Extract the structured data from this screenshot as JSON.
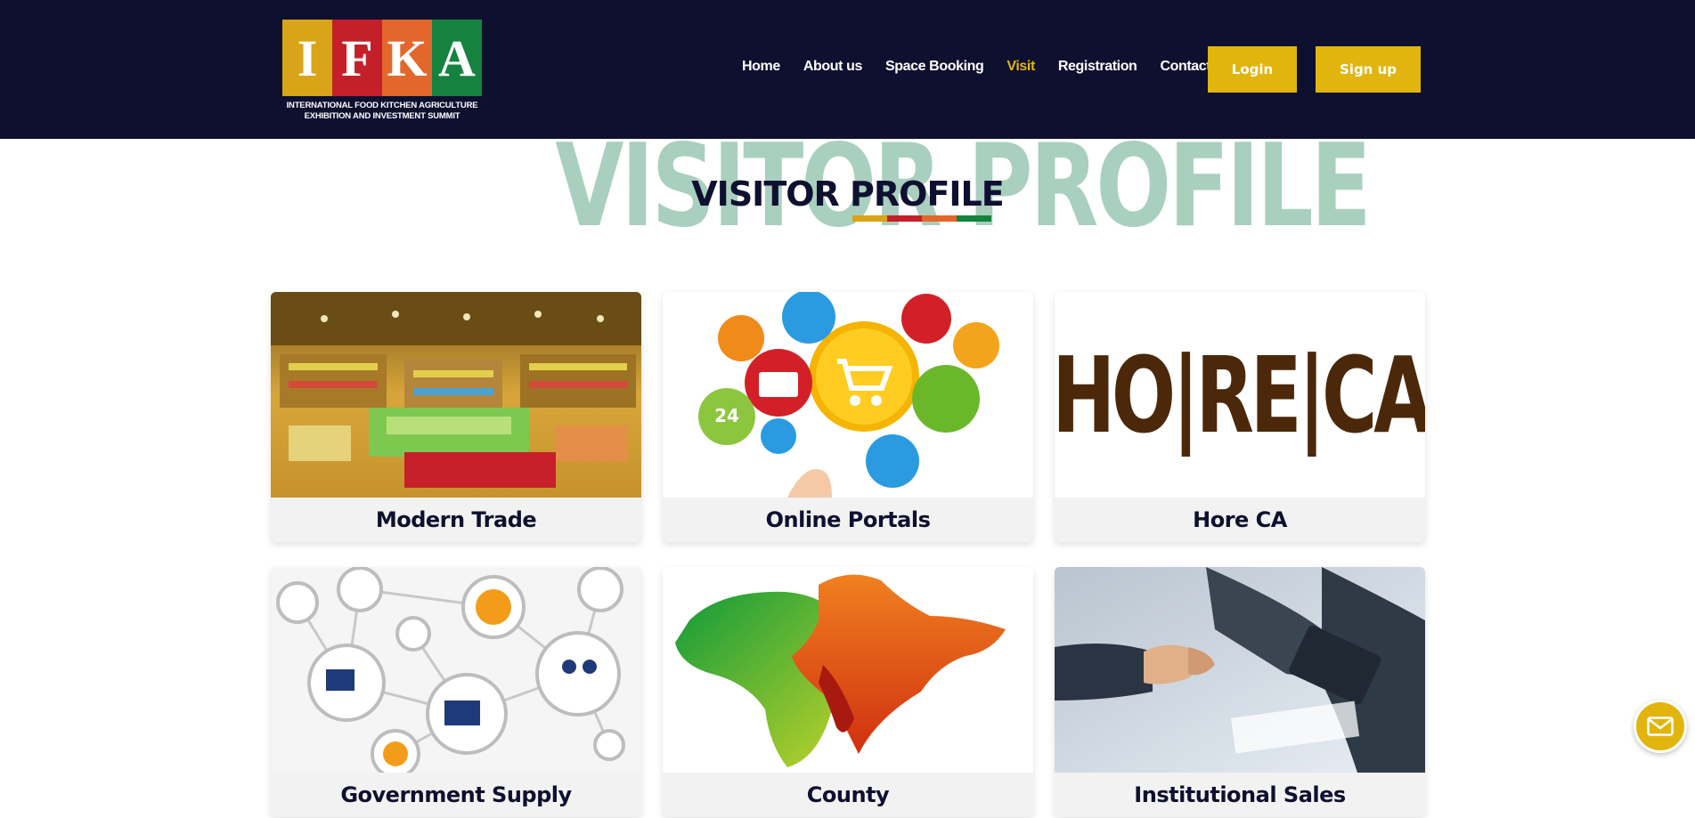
{
  "brand": {
    "letters": [
      "I",
      "F",
      "K",
      "A"
    ],
    "letter_colors": [
      "#d9a417",
      "#c5202a",
      "#e2672b",
      "#16823f"
    ],
    "tagline_line1": "INTERNATIONAL FOOD KITCHEN AGRICULTURE",
    "tagline_line2": "EXHIBITION AND INVESTMENT SUMMIT"
  },
  "nav": {
    "items": [
      {
        "label": "Home",
        "active": false
      },
      {
        "label": "About us",
        "active": false
      },
      {
        "label": "Space Booking",
        "active": false
      },
      {
        "label": "Visit",
        "active": true
      },
      {
        "label": "Registration",
        "active": false
      },
      {
        "label": "Contact us",
        "active": false
      }
    ],
    "login_label": "Login",
    "signup_label": "Sign up"
  },
  "section": {
    "background_title": "VISITOR PROFILE",
    "title": "VISITOR PROFILE",
    "underline_colors": [
      "#d9a417",
      "#c5202a",
      "#e2672b",
      "#16823f"
    ]
  },
  "cards": [
    {
      "label": "Modern Trade",
      "image": "supermarket-photo"
    },
    {
      "label": "Online Portals",
      "image": "ecommerce-icons-illustration"
    },
    {
      "label": "Hore CA",
      "image": "horeca-logo",
      "logo_text": "HO|RE|CA"
    },
    {
      "label": "Government Supply",
      "image": "network-icons-illustration"
    },
    {
      "label": "County",
      "image": "africa-india-map"
    },
    {
      "label": "Institutional Sales",
      "image": "handshake-photo"
    }
  ],
  "colors": {
    "header_bg": "#0e1030",
    "accent": "#e2b50e",
    "title_ghost": "#a9cfbf"
  },
  "fab": {
    "icon": "mail-icon"
  }
}
